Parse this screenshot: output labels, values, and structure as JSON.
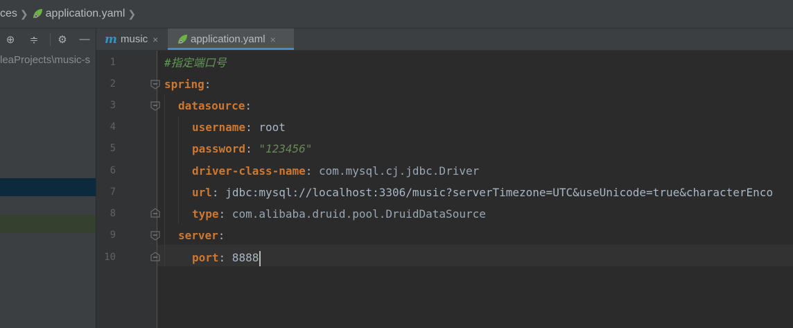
{
  "breadcrumb": {
    "prefix": "ces",
    "file": "application.yaml"
  },
  "project_panel": {
    "path": "leaProjects\\music-s"
  },
  "tabs": [
    {
      "label": "music",
      "icon": "maven-m-icon",
      "close": "×"
    },
    {
      "label": "application.yaml",
      "icon": "spring-leaf-icon",
      "close": "×"
    }
  ],
  "editor": {
    "lines": [
      {
        "num": "1",
        "comment": "#指定端口号"
      },
      {
        "num": "2",
        "key": "spring",
        "colon": ":"
      },
      {
        "num": "3",
        "key": "datasource",
        "colon": ":"
      },
      {
        "num": "4",
        "key": "username",
        "colon": ":",
        "value": " root"
      },
      {
        "num": "5",
        "key": "password",
        "colon": ":",
        "value": " \"123456\""
      },
      {
        "num": "6",
        "key": "driver-class-name",
        "colon": ":",
        "value": " com.mysql.cj.jdbc.Driver"
      },
      {
        "num": "7",
        "key": "url",
        "colon": ":",
        "value": " jdbc:mysql://localhost:3306/music?serverTimezone=UTC&useUnicode=true&characterEnco"
      },
      {
        "num": "8",
        "key": "type",
        "colon": ":",
        "value": " com.alibaba.druid.pool.DruidDataSource"
      },
      {
        "num": "9",
        "key": "server",
        "colon": ":"
      },
      {
        "num": "10",
        "key": "port",
        "colon": ":",
        "value": " 8888"
      }
    ]
  },
  "colors": {
    "key": "#cc7832",
    "comment": "#629755",
    "string": "#6a8759",
    "text": "#a9b7c6",
    "selection_blue": "#0d293e",
    "selection_green": "#35402e"
  }
}
